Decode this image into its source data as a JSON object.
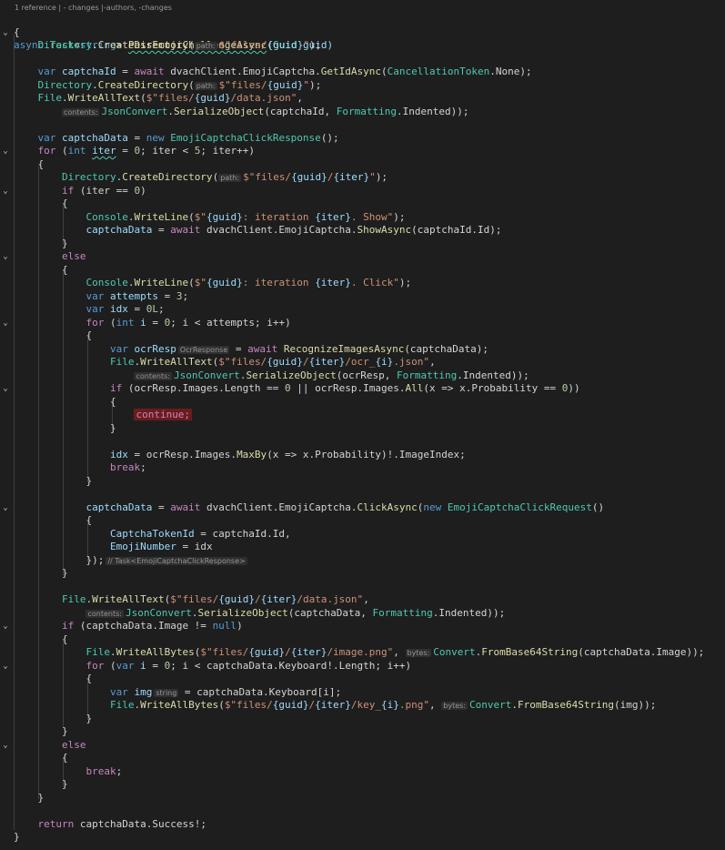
{
  "codelens": {
    "references": "1 reference",
    "changes": "- changes",
    "authors": "-authors, -changes"
  },
  "code": {
    "l01": [
      "async",
      " ",
      "Task",
      "<",
      "string",
      "> ",
      "PassEmojiChallengeAsync",
      "(",
      "Guid",
      " guid)"
    ],
    "l02": [
      "{"
    ],
    "l03": [
      "    ",
      "Directory",
      ".",
      "CreateDirectory",
      "(",
      "path:",
      "$\"files/",
      "{guid}",
      "\"",
      ");"
    ],
    "l05": [
      "    ",
      "var",
      " ",
      "captchaId",
      " = ",
      "await",
      " dvachClient.EmojiCaptcha.",
      "GetIdAsync",
      "(",
      "CancellationToken",
      ".None);"
    ],
    "l06": [
      "    ",
      "Directory",
      ".",
      "CreateDirectory",
      "(",
      "path:",
      "$\"files/",
      "{guid}",
      "\"",
      ");"
    ],
    "l07": [
      "    ",
      "File",
      ".",
      "WriteAllText",
      "(",
      "$\"files/",
      "{guid}",
      "/data.json\"",
      ","
    ],
    "l08": [
      "        ",
      "contents:",
      "JsonConvert",
      ".",
      "SerializeObject",
      "(captchaId, ",
      "Formatting",
      ".Indented));"
    ],
    "l10": [
      "    ",
      "var",
      " ",
      "captchaData",
      " = ",
      "new",
      " ",
      "EmojiCaptchaClickResponse",
      "();"
    ],
    "l11": [
      "    ",
      "for",
      " (",
      "int",
      " ",
      "iter",
      " = ",
      "0",
      "; iter < ",
      "5",
      "; iter++)"
    ],
    "l12": [
      "    {"
    ],
    "l13": [
      "        ",
      "Directory",
      ".",
      "CreateDirectory",
      "(",
      "path:",
      "$\"files/",
      "{guid}",
      "/",
      "{iter}",
      "\"",
      ");"
    ],
    "l14": [
      "        ",
      "if",
      " (iter == ",
      "0",
      ")"
    ],
    "l15": [
      "        {"
    ],
    "l16": [
      "            ",
      "Console",
      ".",
      "WriteLine",
      "(",
      "$\"",
      "{guid}",
      ": iteration ",
      "{iter}",
      ". Show\"",
      ");"
    ],
    "l17": [
      "            ",
      "captchaData",
      " = ",
      "await",
      " dvachClient.EmojiCaptcha.",
      "ShowAsync",
      "(captchaId.Id);"
    ],
    "l18": [
      "        }"
    ],
    "l19": [
      "        ",
      "else"
    ],
    "l20": [
      "        {"
    ],
    "l21": [
      "            ",
      "Console",
      ".",
      "WriteLine",
      "(",
      "$\"",
      "{guid}",
      ": iteration ",
      "{iter}",
      ". Click\"",
      ");"
    ],
    "l22": [
      "            ",
      "var",
      " ",
      "attempts",
      " = ",
      "3",
      ";"
    ],
    "l23": [
      "            ",
      "var",
      " ",
      "idx",
      " = ",
      "0L",
      ";"
    ],
    "l24": [
      "            ",
      "for",
      " (",
      "int",
      " ",
      "i",
      " = ",
      "0",
      "; i < attempts; i++)"
    ],
    "l25": [
      "            {"
    ],
    "l26": [
      "                ",
      "var",
      " ",
      "ocrResp",
      "OcrResponse",
      " = ",
      "await",
      " ",
      "RecognizeImagesAsync",
      "(captchaData);"
    ],
    "l27": [
      "                ",
      "File",
      ".",
      "WriteAllText",
      "(",
      "$\"files/",
      "{guid}",
      "/",
      "{iter}",
      "/ocr_",
      "{i}",
      ".json\"",
      ","
    ],
    "l28": [
      "                    ",
      "contents:",
      "JsonConvert",
      ".",
      "SerializeObject",
      "(ocrResp, ",
      "Formatting",
      ".Indented));"
    ],
    "l29": [
      "                ",
      "if",
      " (ocrResp.Images.Length == ",
      "0",
      " || ocrResp.Images.",
      "All",
      "(x => x.Probability == ",
      "0",
      "))"
    ],
    "l30": [
      "                {"
    ],
    "l31": [
      "                    ",
      "continue;"
    ],
    "l32": [
      "                }"
    ],
    "l34": [
      "                ",
      "idx",
      " = ocrResp.Images.",
      "MaxBy",
      "(x => x.Probability)!.ImageIndex;"
    ],
    "l35": [
      "                ",
      "break",
      ";"
    ],
    "l36": [
      "            }"
    ],
    "l38": [
      "            ",
      "captchaData",
      " = ",
      "await",
      " dvachClient.EmojiCaptcha.",
      "ClickAsync",
      "(",
      "new",
      " ",
      "EmojiCaptchaClickRequest",
      "()"
    ],
    "l39": [
      "            {"
    ],
    "l40": [
      "                ",
      "CaptchaTokenId",
      " = captchaId.Id,"
    ],
    "l41": [
      "                ",
      "EmojiNumber",
      " = idx"
    ],
    "l42": [
      "            });",
      "// Task<EmojiCaptchaClickResponse>"
    ],
    "l43": [
      "        }"
    ],
    "l45": [
      "        ",
      "File",
      ".",
      "WriteAllText",
      "(",
      "$\"files/",
      "{guid}",
      "/",
      "{iter}",
      "/data.json\"",
      ","
    ],
    "l46": [
      "            ",
      "contents:",
      "JsonConvert",
      ".",
      "SerializeObject",
      "(captchaData, ",
      "Formatting",
      ".Indented));"
    ],
    "l47": [
      "        ",
      "if",
      " (captchaData.Image != ",
      "null",
      ")"
    ],
    "l48": [
      "        {"
    ],
    "l49": [
      "            ",
      "File",
      ".",
      "WriteAllBytes",
      "(",
      "$\"files/",
      "{guid}",
      "/",
      "{iter}",
      "/image.png\"",
      ", ",
      "bytes:",
      "Convert",
      ".",
      "FromBase64String",
      "(captchaData.Image));"
    ],
    "l50": [
      "            ",
      "for",
      " (",
      "var",
      " ",
      "i",
      " = ",
      "0",
      "; i < captchaData.Keyboard!.Length; i++)"
    ],
    "l51": [
      "            {"
    ],
    "l52": [
      "                ",
      "var",
      " ",
      "img",
      "string",
      " = captchaData.Keyboard[i];"
    ],
    "l53": [
      "                ",
      "File",
      ".",
      "WriteAllBytes",
      "(",
      "$\"files/",
      "{guid}",
      "/",
      "{iter}",
      "/key_",
      "{i}",
      ".png\"",
      ", ",
      "bytes:",
      "Convert",
      ".",
      "FromBase64String",
      "(img));"
    ],
    "l54": [
      "            }"
    ],
    "l55": [
      "        }"
    ],
    "l56": [
      "        ",
      "else"
    ],
    "l57": [
      "        {"
    ],
    "l58": [
      "            ",
      "break",
      ";"
    ],
    "l59": [
      "        }"
    ],
    "l60": [
      "    }"
    ],
    "l62": [
      "    ",
      "return",
      " captchaData.Success!;"
    ],
    "l63": [
      "}"
    ]
  },
  "colors": {
    "background": "#1e1e1e",
    "keyword": "#569cd6",
    "control": "#c586c0",
    "type": "#4ec9b0",
    "method": "#dcdcaa",
    "variable": "#9cdcfe",
    "string": "#ce9178",
    "number": "#b5cea8",
    "comment": "#6a9955",
    "error_highlight": "#6b1c1c"
  },
  "icons": {
    "fold_open": "chevron-down-icon"
  }
}
